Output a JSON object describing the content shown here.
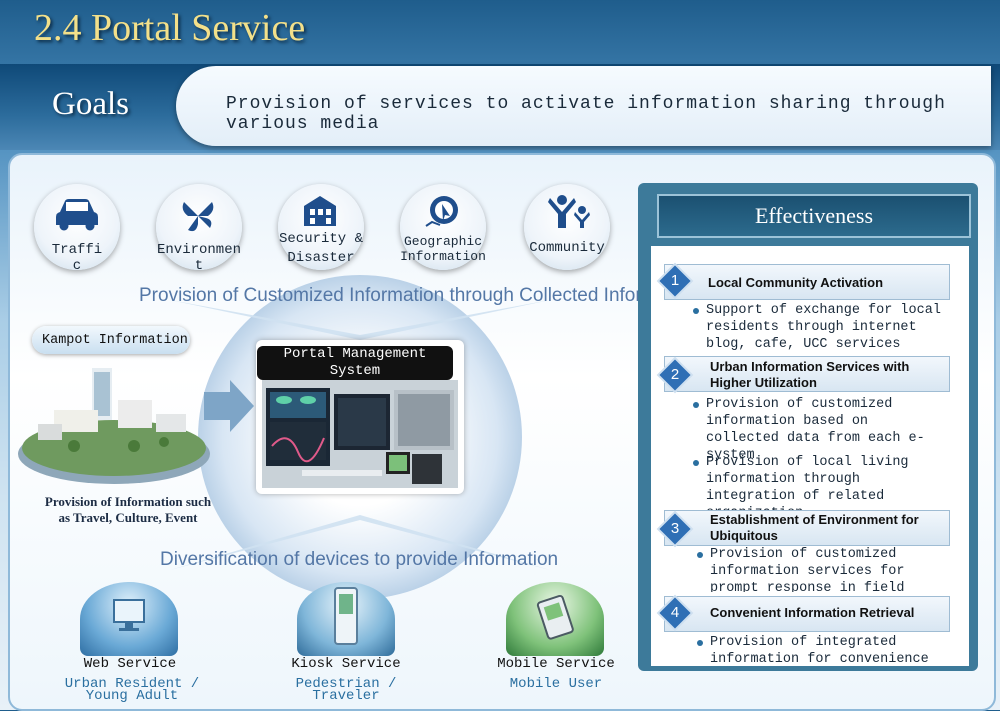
{
  "title": "2.4 Portal Service",
  "goals": {
    "label": "Goals",
    "text": "Provision of services to activate information sharing through various media"
  },
  "categories": [
    {
      "label": "Traffi\nc",
      "icon": "car-icon"
    },
    {
      "label": "Environmen\nt",
      "icon": "leaf-icon"
    },
    {
      "label": "Security &\nDisaster",
      "icon": "building-icon"
    },
    {
      "label": "Geographic\nInformation",
      "icon": "map-cursor-icon"
    },
    {
      "label": "Community",
      "icon": "people-icon"
    }
  ],
  "headline_top": "Provision of Customized Information through Collected Information",
  "headline_bottom": "Diversification of devices to provide Information",
  "kampot": {
    "label": "Kampot Information",
    "caption": "Provision of Information such as Travel, Culture, Event"
  },
  "pms": {
    "title": "Portal Management System"
  },
  "effectiveness": {
    "title": "Effectiveness",
    "items": [
      {
        "num": "1",
        "heading": "Local Community Activation",
        "bullets": [
          "Support of exchange for local residents through internet blog, cafe, UCC services"
        ]
      },
      {
        "num": "2",
        "heading": "Urban Information Services with Higher Utilization",
        "bullets": [
          "Provision of customized information based on collected data from each e-system",
          "Provision of local living information through integration of related organization"
        ]
      },
      {
        "num": "3",
        "heading": "Establishment of Environment for Ubiquitous",
        "bullets": [
          "Provision of customized information services for prompt response in field through mobile,"
        ]
      },
      {
        "num": "4",
        "heading": "Convenient Information Retrieval",
        "bullets": [
          "Provision of integrated information for convenience"
        ]
      }
    ]
  },
  "devices": [
    {
      "label": "Web Service",
      "sub": "Urban Resident / Young Adult",
      "icon": "computer-icon"
    },
    {
      "label": "Kiosk Service",
      "sub": "Pedestrian / Traveler",
      "icon": "kiosk-icon"
    },
    {
      "label": "Mobile Service",
      "sub": "Mobile User",
      "icon": "mobile-phone-icon"
    }
  ]
}
